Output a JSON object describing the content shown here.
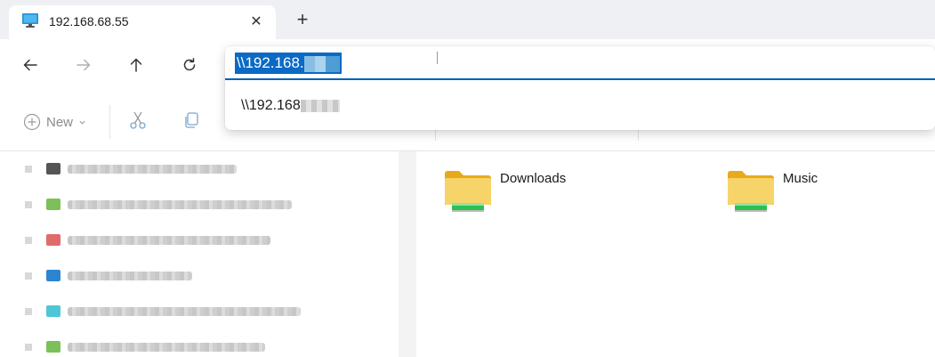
{
  "tab": {
    "title": "192.168.68.55",
    "close_glyph": "✕",
    "new_tab_glyph": "+"
  },
  "nav": {
    "back_icon": "arrow-left-icon",
    "forward_icon": "arrow-right-icon",
    "up_icon": "arrow-up-icon",
    "refresh_icon": "refresh-icon"
  },
  "address": {
    "value": "\\\\192.168.",
    "suggestion": "\\\\192.168"
  },
  "command_bar": {
    "new_label": "New"
  },
  "content": {
    "folders": [
      {
        "name": "Downloads"
      },
      {
        "name": "Music"
      }
    ]
  },
  "colors": {
    "accent": "#005fb8",
    "selection": "#0a6ac5",
    "folder_yellow": "#f7c948",
    "drive_green": "#2fbf4f"
  }
}
